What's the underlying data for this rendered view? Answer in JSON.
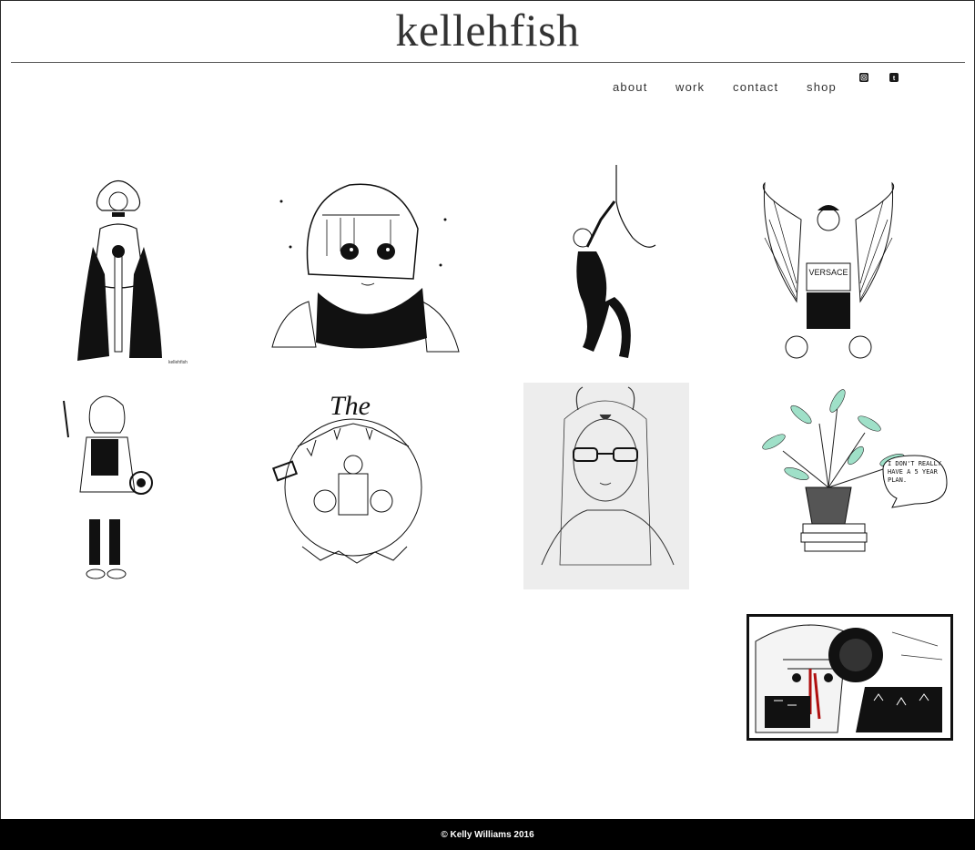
{
  "site": {
    "title": "kellehfish"
  },
  "nav": {
    "items": [
      {
        "label": "about"
      },
      {
        "label": "work"
      },
      {
        "label": "contact"
      },
      {
        "label": "shop"
      }
    ],
    "social": [
      {
        "icon": "instagram-icon"
      },
      {
        "icon": "tumblr-icon"
      }
    ]
  },
  "gallery": {
    "artworks": [
      {
        "name": "girl-with-sword"
      },
      {
        "name": "girl-with-scarf"
      },
      {
        "name": "spider-gwen-hanging"
      },
      {
        "name": "versace-angel",
        "text": "VERSACE"
      },
      {
        "name": "girl-with-knife"
      },
      {
        "name": "the-wreath",
        "text": "The"
      },
      {
        "name": "horned-girl-glasses"
      },
      {
        "name": "plant-five-year-plan",
        "text": "I DON'T REALLY HAVE A 5 YEAR PLAN."
      },
      {
        "name": "bloody-headphones-girl"
      }
    ]
  },
  "footer": {
    "text": "© Kelly Williams 2016"
  }
}
